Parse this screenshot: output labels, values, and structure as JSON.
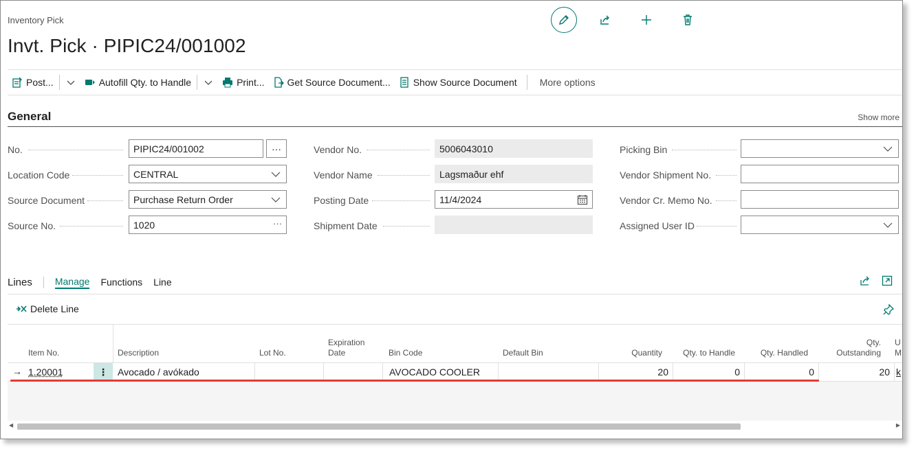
{
  "header": {
    "page_kind": "Inventory Pick",
    "title": "Invt. Pick · PIPIC24/001002"
  },
  "actions": {
    "post": "Post...",
    "autofill": "Autofill Qty. to Handle",
    "print": "Print...",
    "get_source": "Get Source Document...",
    "show_source": "Show Source Document",
    "more": "More options"
  },
  "general": {
    "title": "General",
    "show_more": "Show more",
    "no": {
      "label": "No.",
      "value": "PIPIC24/001002",
      "assist": "···"
    },
    "location_code": {
      "label": "Location Code",
      "value": "CENTRAL"
    },
    "source_document": {
      "label": "Source Document",
      "value": "Purchase Return Order"
    },
    "source_no": {
      "label": "Source No.",
      "value": "1020",
      "assist": "···"
    },
    "vendor_no": {
      "label": "Vendor No.",
      "value": "5006043010"
    },
    "vendor_name": {
      "label": "Vendor Name",
      "value": "Lagsmaður ehf"
    },
    "posting_date": {
      "label": "Posting Date",
      "value": "11/4/2024"
    },
    "shipment_date": {
      "label": "Shipment Date",
      "value": ""
    },
    "picking_bin": {
      "label": "Picking Bin",
      "value": ""
    },
    "vendor_shipment_no": {
      "label": "Vendor Shipment No.",
      "value": ""
    },
    "vendor_cr_memo_no": {
      "label": "Vendor Cr. Memo No.",
      "value": ""
    },
    "assigned_user_id": {
      "label": "Assigned User ID",
      "value": ""
    }
  },
  "lines": {
    "title": "Lines",
    "tabs": [
      "Manage",
      "Functions",
      "Line"
    ],
    "delete_line": "Delete Line",
    "columns": {
      "item_no": "Item No.",
      "description": "Description",
      "lot_no": "Lot No.",
      "expiration_date_1": "Expiration",
      "expiration_date_2": "Date",
      "bin_code": "Bin Code",
      "default_bin": "Default Bin",
      "quantity": "Quantity",
      "qty_to_handle": "Qty. to Handle",
      "qty_handled": "Qty. Handled",
      "qty_outstanding_1": "Qty.",
      "qty_outstanding_2": "Outstanding",
      "partial_1": "U",
      "partial_2": "M"
    },
    "rows": [
      {
        "arrow": "→",
        "item_no": "1.20001",
        "menu": "⋮",
        "description": "Avocado / avókado",
        "lot_no": "",
        "expiration_date": "",
        "bin_code": "AVOCADO COOLER",
        "default_bin": "",
        "quantity": "20",
        "qty_to_handle": "0",
        "qty_handled": "0",
        "qty_outstanding": "20",
        "partial": "k"
      }
    ]
  },
  "colors": {
    "accent": "#00796f",
    "highlight": "#e53935"
  }
}
